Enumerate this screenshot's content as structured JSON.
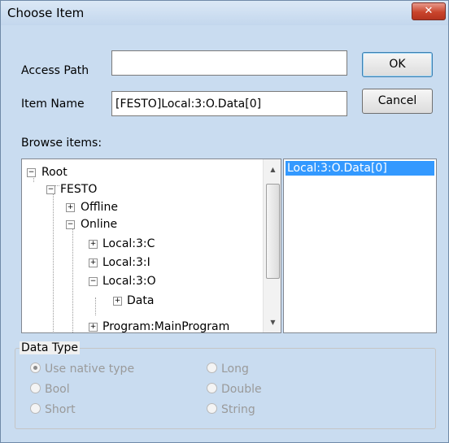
{
  "window": {
    "title": "Choose Item",
    "close_glyph": "✕"
  },
  "form": {
    "access_path_label": "Access Path",
    "access_path_value": "",
    "item_name_label": "Item Name",
    "item_name_value": "[FESTO]Local:3:O.Data[0]",
    "ok_label": "OK",
    "cancel_label": "Cancel",
    "browse_label": "Browse items:"
  },
  "tree": {
    "nodes": [
      {
        "label": "Root",
        "state": "expanded"
      },
      {
        "label": "FESTO",
        "state": "expanded"
      },
      {
        "label": "Offline",
        "state": "collapsed"
      },
      {
        "label": "Online",
        "state": "expanded"
      },
      {
        "label": "Local:3:C",
        "state": "collapsed"
      },
      {
        "label": "Local:3:I",
        "state": "collapsed"
      },
      {
        "label": "Local:3:O",
        "state": "expanded"
      },
      {
        "label": "Data",
        "state": "collapsed"
      },
      {
        "label": "Program:MainProgram",
        "state": "collapsed"
      }
    ]
  },
  "items_list": {
    "selected": "Local:3:O.Data[0]"
  },
  "data_type": {
    "label": "Data Type",
    "options": [
      {
        "label": "Use native type",
        "checked": true
      },
      {
        "label": "Bool",
        "checked": false
      },
      {
        "label": "Short",
        "checked": false
      },
      {
        "label": "Long",
        "checked": false
      },
      {
        "label": "Double",
        "checked": false
      },
      {
        "label": "String",
        "checked": false
      }
    ]
  },
  "colors": {
    "selection": "#3399ff",
    "close_button": "#c9442c",
    "title_bar": "#c9dcf0"
  }
}
